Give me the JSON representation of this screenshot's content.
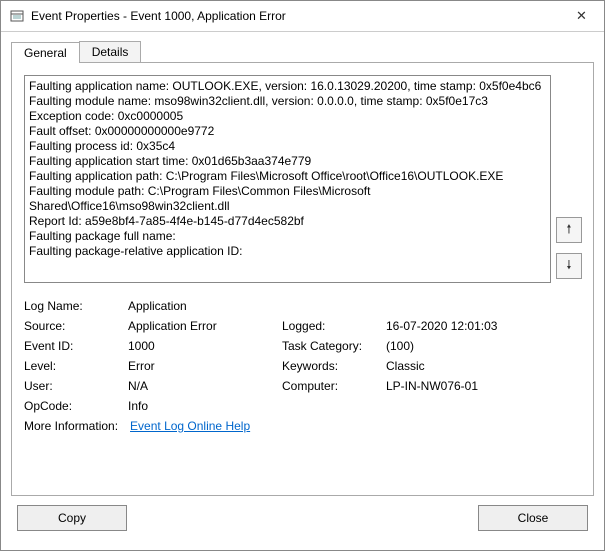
{
  "window": {
    "title": "Event Properties - Event 1000, Application Error",
    "close_icon": "✕"
  },
  "tabs": {
    "general": "General",
    "details": "Details"
  },
  "description": "Faulting application name: OUTLOOK.EXE, version: 16.0.13029.20200, time stamp: 0x5f0e4bc6\nFaulting module name: mso98win32client.dll, version: 0.0.0.0, time stamp: 0x5f0e17c3\nException code: 0xc0000005\nFault offset: 0x00000000000e9772\nFaulting process id: 0x35c4\nFaulting application start time: 0x01d65b3aa374e779\nFaulting application path: C:\\Program Files\\Microsoft Office\\root\\Office16\\OUTLOOK.EXE\nFaulting module path: C:\\Program Files\\Common Files\\Microsoft Shared\\Office16\\mso98win32client.dll\nReport Id: a59e8bf4-7a85-4f4e-b145-d77d4ec582bf\nFaulting package full name:\nFaulting package-relative application ID:",
  "arrows": {
    "up": "🠕",
    "down": "🠗"
  },
  "fields": {
    "logname_label": "Log Name:",
    "logname_value": "Application",
    "source_label": "Source:",
    "source_value": "Application Error",
    "logged_label": "Logged:",
    "logged_value": "16-07-2020 12:01:03",
    "eventid_label": "Event ID:",
    "eventid_value": "1000",
    "taskcat_label": "Task Category:",
    "taskcat_value": "(100)",
    "level_label": "Level:",
    "level_value": "Error",
    "keywords_label": "Keywords:",
    "keywords_value": "Classic",
    "user_label": "User:",
    "user_value": "N/A",
    "computer_label": "Computer:",
    "computer_value": "LP-IN-NW076-01",
    "opcode_label": "OpCode:",
    "opcode_value": "Info",
    "moreinfo_label": "More Information:",
    "moreinfo_link": "Event Log Online Help"
  },
  "buttons": {
    "copy": "Copy",
    "close": "Close"
  }
}
